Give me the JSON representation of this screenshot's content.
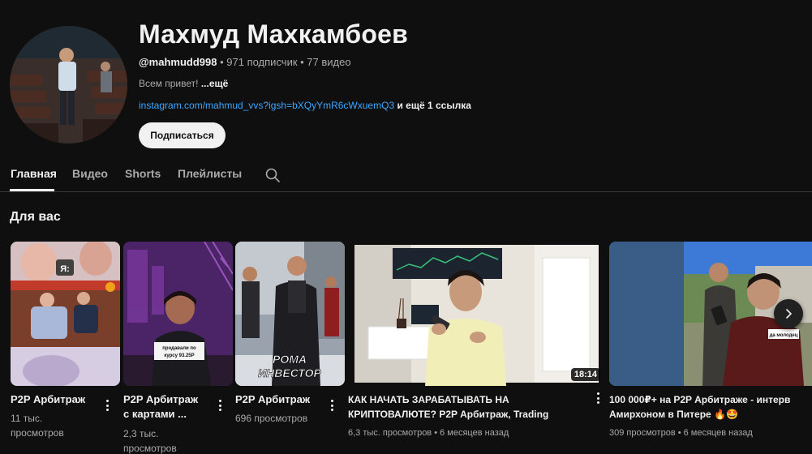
{
  "channel": {
    "name": "Махмуд Махкамбоев",
    "handle": "@mahmudd998",
    "separator": " • ",
    "subscribers": "971 подписчик",
    "videos": "77 видео",
    "description": "Всем привет! ",
    "description_more": "...ещё",
    "link": "instagram.com/mahmud_vvs?igsh=bXQyYmR6cWxuemQ3",
    "link_more": " и ещё 1 ссылка",
    "subscribe_label": "Подписаться"
  },
  "tabs": [
    {
      "label": "Главная",
      "active": true
    },
    {
      "label": "Видео",
      "active": false
    },
    {
      "label": "Shorts",
      "active": false
    },
    {
      "label": "Плейлисты",
      "active": false
    }
  ],
  "section": {
    "title": "Для вас"
  },
  "videos": [
    {
      "title": "P2P Арбитраж",
      "views": "11 тыс.",
      "views2": "просмотров",
      "overlay": "Я:"
    },
    {
      "title": "P2P Арбитраж",
      "title2": "с картами ...",
      "views": "2,3 тыс.",
      "views2": "просмотров",
      "overlay": "продавали по курсу 93.25Р"
    },
    {
      "title": "P2P Арбитраж",
      "views": "696 просмотров",
      "overlay": "РОМА",
      "overlay2": "ИНВЕСТОР"
    },
    {
      "title": "КАК НАЧАТЬ ЗАРАБАТЫВАТЬ НА",
      "title2": "КРИПТОВАЛЮТЕ? P2P Арбитраж, Trading",
      "meta": "6,3 тыс. просмотров • 6 месяцев назад",
      "duration": "18:14"
    },
    {
      "title": "100 000₽+ на P2P Арбитраже - интерв",
      "title2": "Амирхоном в Питере 🔥🤩",
      "meta": "309 просмотров • 6 месяцев назад",
      "overlay": "да молодец"
    }
  ],
  "icons": {
    "search": "search-icon",
    "more": "more-vert-icon",
    "next": "chevron-right-icon"
  }
}
